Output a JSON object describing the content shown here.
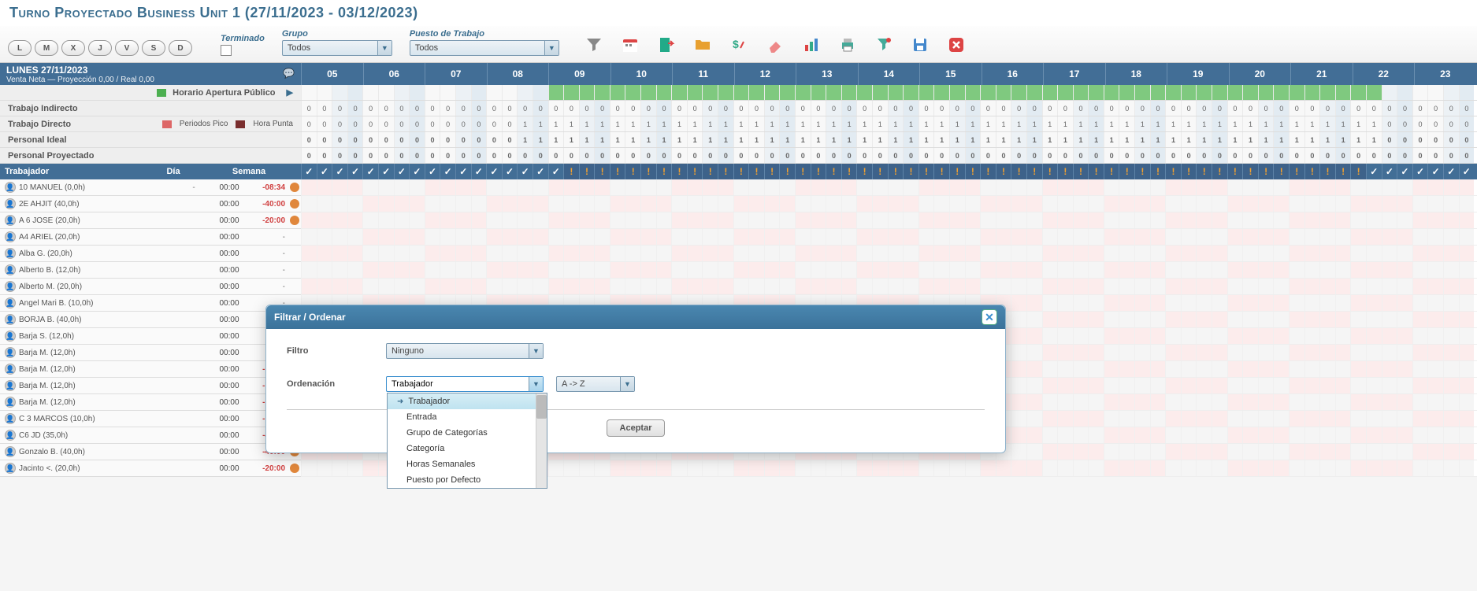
{
  "title": "Turno Proyectado Business Unit 1 (27/11/2023 - 03/12/2023)",
  "days": [
    "L",
    "M",
    "X",
    "J",
    "V",
    "S",
    "D"
  ],
  "labels": {
    "terminado": "Terminado",
    "grupo": "Grupo",
    "puesto": "Puesto de Trabajo"
  },
  "selects": {
    "grupo": "Todos",
    "puesto": "Todos"
  },
  "hours": [
    "05",
    "06",
    "07",
    "08",
    "09",
    "10",
    "11",
    "12",
    "13",
    "14",
    "15",
    "16",
    "17",
    "18",
    "19",
    "20",
    "21",
    "22",
    "23"
  ],
  "date_header": "LUNES 27/11/2023",
  "venta_line": "Venta Neta  —  Proyección 0,00  /  Real 0,00",
  "apertura": "Horario Apertura Público",
  "summary_rows": [
    {
      "label": "Trabajo Indirecto",
      "extras": []
    },
    {
      "label": "Trabajo Directo",
      "extras": [
        {
          "text": "Periodos Pico",
          "color": "#d66"
        },
        {
          "text": "Hora Punta",
          "color": "#7a2e2e"
        }
      ]
    },
    {
      "label": "Personal Ideal",
      "bold": true
    },
    {
      "label": "Personal Proyectado",
      "bold": true
    }
  ],
  "worker_header": {
    "trabajador": "Trabajador",
    "dia": "Día",
    "semana": "Semana"
  },
  "workers": [
    {
      "name": "10 MANUEL (0,0h)",
      "day": "-",
      "week": "00:00",
      "dev": "-08:34",
      "dot": true
    },
    {
      "name": "2E AHJIT (40,0h)",
      "day": "",
      "week": "00:00",
      "dev": "-40:00",
      "dot": true
    },
    {
      "name": "A 6 JOSE (20,0h)",
      "day": "",
      "week": "00:00",
      "dev": "-20:00",
      "dot": true
    },
    {
      "name": "A4 ARIEL (20,0h)",
      "day": "",
      "week": "00:00",
      "dev": "-",
      "dot": false
    },
    {
      "name": "Alba G. (20,0h)",
      "day": "",
      "week": "00:00",
      "dev": "-",
      "dot": false
    },
    {
      "name": "Alberto B. (12,0h)",
      "day": "",
      "week": "00:00",
      "dev": "-",
      "dot": false
    },
    {
      "name": "Alberto M. (20,0h)",
      "day": "",
      "week": "00:00",
      "dev": "-",
      "dot": false
    },
    {
      "name": "Angel Mari B. (10,0h)",
      "day": "",
      "week": "00:00",
      "dev": "-",
      "dot": false
    },
    {
      "name": "BORJA B. (40,0h)",
      "day": "",
      "week": "00:00",
      "dev": "-",
      "dot": false
    },
    {
      "name": "Barja S. (12,0h)",
      "day": "",
      "week": "00:00",
      "dev": "-",
      "dot": false
    },
    {
      "name": "Barja M. (12,0h)",
      "day": "",
      "week": "00:00",
      "dev": "-",
      "dot": false
    },
    {
      "name": "Barja M. (12,0h)",
      "day": "",
      "week": "00:00",
      "dev": "-12:00",
      "dot": true
    },
    {
      "name": "Barja M. (12,0h)",
      "day": "",
      "week": "00:00",
      "dev": "-12:00",
      "dot": true
    },
    {
      "name": "Barja M. (12,0h)",
      "day": "",
      "week": "00:00",
      "dev": "-12:00",
      "dot": true
    },
    {
      "name": "C 3 MARCOS (10,0h)",
      "day": "",
      "week": "00:00",
      "dev": "-10:00",
      "dot": true
    },
    {
      "name": "C6 JD (35,0h)",
      "day": "",
      "week": "00:00",
      "dev": "-49:00",
      "dot": true
    },
    {
      "name": "Gonzalo B. (40,0h)",
      "day": "",
      "week": "00:00",
      "dev": "-40:00",
      "dot": true
    },
    {
      "name": "Jacinto <. (20,0h)",
      "day": "",
      "week": "00:00",
      "dev": "-20:00",
      "dot": true
    }
  ],
  "modal": {
    "title": "Filtrar / Ordenar",
    "filtro_label": "Filtro",
    "filtro_value": "Ninguno",
    "orden_label": "Ordenación",
    "orden_value": "Trabajador",
    "dir_value": "A -> Z",
    "accept": "Aceptar",
    "options": [
      "Trabajador",
      "Entrada",
      "Grupo de Categorías",
      "Categoría",
      "Horas Semanales",
      "Puesto por Defecto"
    ]
  },
  "summary_values": {
    "indirect": "0",
    "direct_early": "0",
    "direct_late": "1",
    "ideal_early": "0",
    "ideal_late": "1",
    "proj": "0"
  },
  "flags": {
    "ok_count_leading": 17,
    "warn_count": 52,
    "ok_count_trailing": 7
  }
}
